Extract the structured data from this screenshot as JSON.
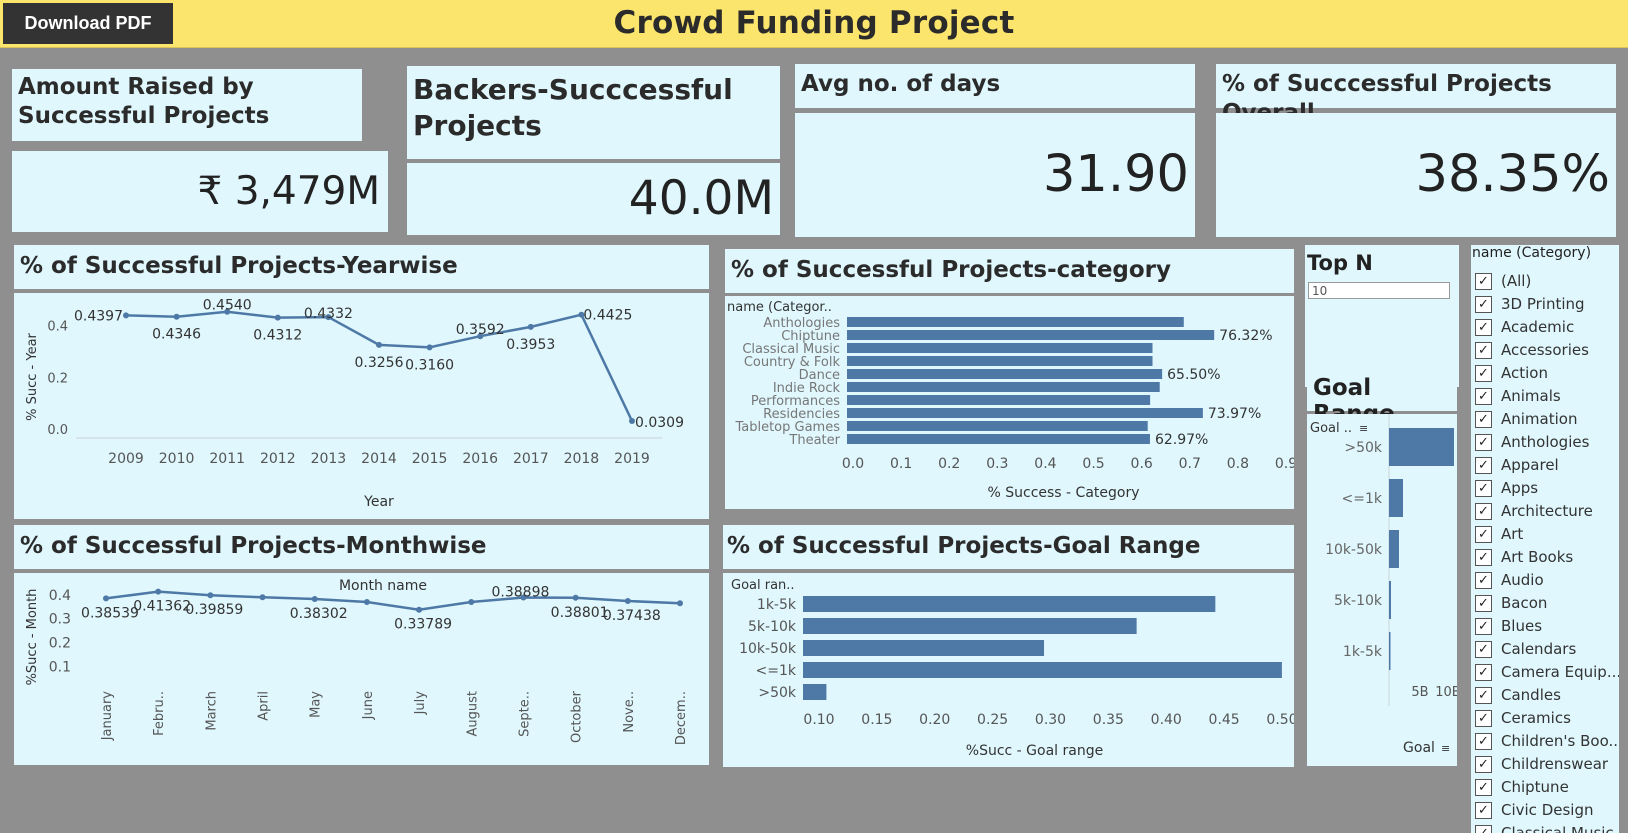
{
  "header": {
    "title": "Crowd Funding Project",
    "download_label": "Download PDF"
  },
  "kpis": [
    {
      "title": "Amount Raised by Successful Projects",
      "value": "₹ 3,479M"
    },
    {
      "title": "Backers-Succcessful Projects",
      "value": "40.0M"
    },
    {
      "title": "Avg no. of days",
      "value": "31.90"
    },
    {
      "title": "% of Succcessful Projects Overall",
      "value": "38.35%"
    }
  ],
  "yearwise": {
    "title": "% of Successful Projects-Yearwise",
    "chart_data": {
      "type": "line",
      "x": [
        "2009",
        "2010",
        "2011",
        "2012",
        "2013",
        "2014",
        "2015",
        "2016",
        "2017",
        "2018",
        "2019"
      ],
      "values": [
        0.4397,
        0.4346,
        0.454,
        0.4312,
        0.4332,
        0.3256,
        0.316,
        0.3592,
        0.3953,
        0.4425,
        0.0309
      ],
      "labels": [
        "0.4397",
        "0.4346",
        "0.4540",
        "0.4312",
        "0.4332",
        "0.3256",
        "0.3160",
        "0.3592",
        "0.3953",
        "0.4425",
        "0.0309"
      ],
      "xlabel": "Year",
      "ylabel": "% Succ - Year",
      "yticks": [
        "0.0",
        "0.2",
        "0.4"
      ],
      "ylim": [
        0,
        0.48
      ]
    }
  },
  "monthwise": {
    "title": "% of Successful Projects-Monthwise",
    "chart_data": {
      "type": "line",
      "x_header": "Month name",
      "x": [
        "January",
        "Febru..",
        "March",
        "April",
        "May",
        "June",
        "July",
        "August",
        "Septe..",
        "October",
        "Nove..",
        "Decem.."
      ],
      "values": [
        0.38539,
        0.41362,
        0.39859,
        0.39,
        0.38302,
        0.37,
        0.33789,
        0.37,
        0.38898,
        0.38801,
        0.37438,
        0.365
      ],
      "labels": [
        "0.38539",
        "0.41362",
        "0.39859",
        "",
        "0.38302",
        "",
        "0.33789",
        "",
        "0.38898",
        "0.38801",
        "0.37438",
        ""
      ],
      "ylabel": "%Succ - Month",
      "yticks": [
        "0.1",
        "0.2",
        "0.3",
        "0.4"
      ],
      "ylim": [
        0.03,
        0.45
      ]
    }
  },
  "category": {
    "title": "% of Successful Projects-category",
    "chart_data": {
      "type": "bar",
      "row_header": "name (Categor..",
      "categories": [
        "Anthologies",
        "Chiptune",
        "Classical Music",
        "Country & Folk",
        "Dance",
        "Indie Rock",
        "Performances",
        "Residencies",
        "Tabletop Games",
        "Theater"
      ],
      "values": [
        0.7,
        0.7632,
        0.635,
        0.635,
        0.655,
        0.65,
        0.63,
        0.7397,
        0.625,
        0.6297
      ],
      "labels": [
        "",
        "76.32%",
        "",
        "",
        "65.50%",
        "",
        "",
        "73.97%",
        "",
        "62.97%"
      ],
      "xlabel": "% Success - Category",
      "xticks": [
        "0.0",
        "0.1",
        "0.2",
        "0.3",
        "0.4",
        "0.5",
        "0.6",
        "0.7",
        "0.8",
        "0.9"
      ],
      "xlim": [
        0,
        0.9
      ]
    }
  },
  "goal_range_chart": {
    "title": "% of Successful Projects-Goal Range",
    "chart_data": {
      "type": "bar",
      "row_header": "Goal ran..",
      "categories": [
        "1k-5k",
        "5k-10k",
        "10k-50k",
        "<=1k",
        ">50k"
      ],
      "values": [
        0.445,
        0.377,
        0.297,
        0.5025,
        0.109
      ],
      "xlabel": "%Succ - Goal range",
      "xticks": [
        "0.10",
        "0.15",
        "0.20",
        "0.25",
        "0.30",
        "0.35",
        "0.40",
        "0.45",
        "0.50"
      ],
      "xlim": [
        0.1,
        0.5
      ]
    }
  },
  "top_n": {
    "title": "Top N",
    "value": "10"
  },
  "goal_range_side": {
    "title": "Goal Range",
    "row_header": "Goal ..",
    "chart_data": {
      "type": "bar",
      "categories": [
        ">50k",
        "<=1k",
        "10k-50k",
        "5k-10k",
        "1k-5k"
      ],
      "values": [
        6.5,
        1.4,
        1.0,
        0.2,
        0.1
      ],
      "xlabel": "Goal",
      "xticks": [
        "5B",
        "10B"
      ],
      "unit": "B"
    }
  },
  "category_filter": {
    "title": "name (Category)",
    "items": [
      "(All)",
      "3D Printing",
      "Academic",
      "Accessories",
      "Action",
      "Animals",
      "Animation",
      "Anthologies",
      "Apparel",
      "Apps",
      "Architecture",
      "Art",
      "Art Books",
      "Audio",
      "Bacon",
      "Blues",
      "Calendars",
      "Camera Equip...",
      "Candles",
      "Ceramics",
      "Children's Boo...",
      "Childrenswear",
      "Chiptune",
      "Civic Design",
      "Classical Music"
    ]
  },
  "colors": {
    "bar": "#4e79a7",
    "panel": "#dff7fd",
    "header": "#fce56c",
    "background": "#8f8f8f"
  }
}
